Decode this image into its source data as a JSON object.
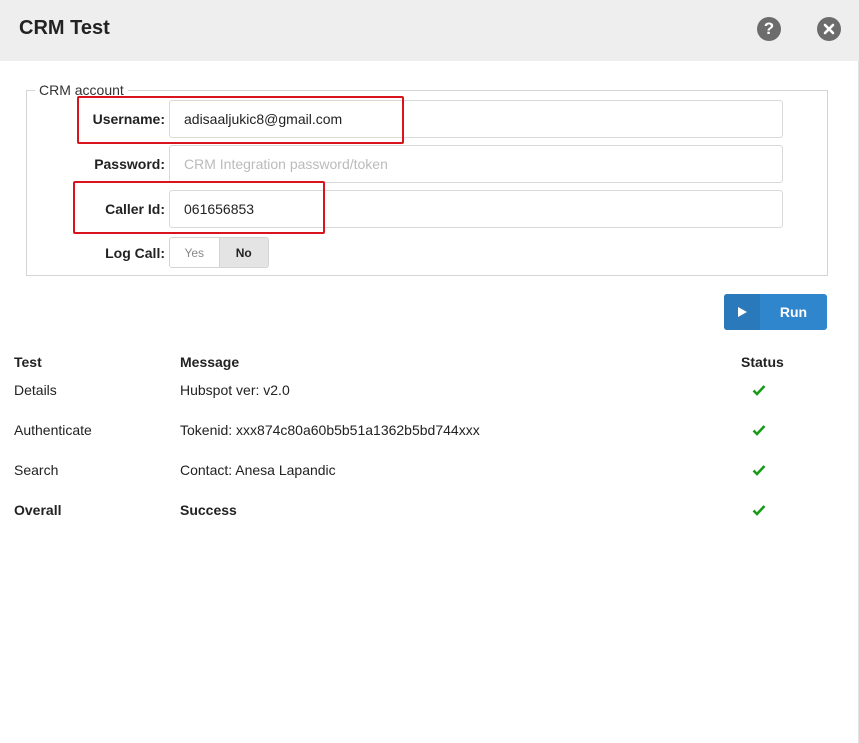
{
  "window": {
    "title": "CRM Test"
  },
  "icons": {
    "help": "help-icon",
    "close": "close-icon",
    "play": "play-icon",
    "check": "check-icon"
  },
  "colors": {
    "accent": "#2f86cc",
    "success": "#1a9a1a",
    "highlight": "#d9141c"
  },
  "crm_account": {
    "legend": "CRM account",
    "username": {
      "label": "Username:",
      "value": "adisaaljukic8@gmail.com"
    },
    "password": {
      "label": "Password:",
      "placeholder": "CRM Integration password/token",
      "value": ""
    },
    "caller_id": {
      "label": "Caller Id:",
      "value": "061656853"
    },
    "log_call": {
      "label": "Log Call:",
      "options": [
        "Yes",
        "No"
      ],
      "selected": "No"
    }
  },
  "run_button": {
    "label": "Run"
  },
  "results": {
    "headers": {
      "test": "Test",
      "message": "Message",
      "status": "Status"
    },
    "rows": [
      {
        "test": "Details",
        "message": "Hubspot ver: v2.0",
        "status": "success"
      },
      {
        "test": "Authenticate",
        "message": "Tokenid: xxx874c80a60b5b51a1362b5bd744xxx",
        "status": "success"
      },
      {
        "test": "Search",
        "message": "Contact: Anesa Lapandic",
        "status": "success"
      },
      {
        "test": "Overall",
        "message": "Success",
        "status": "success"
      }
    ]
  }
}
